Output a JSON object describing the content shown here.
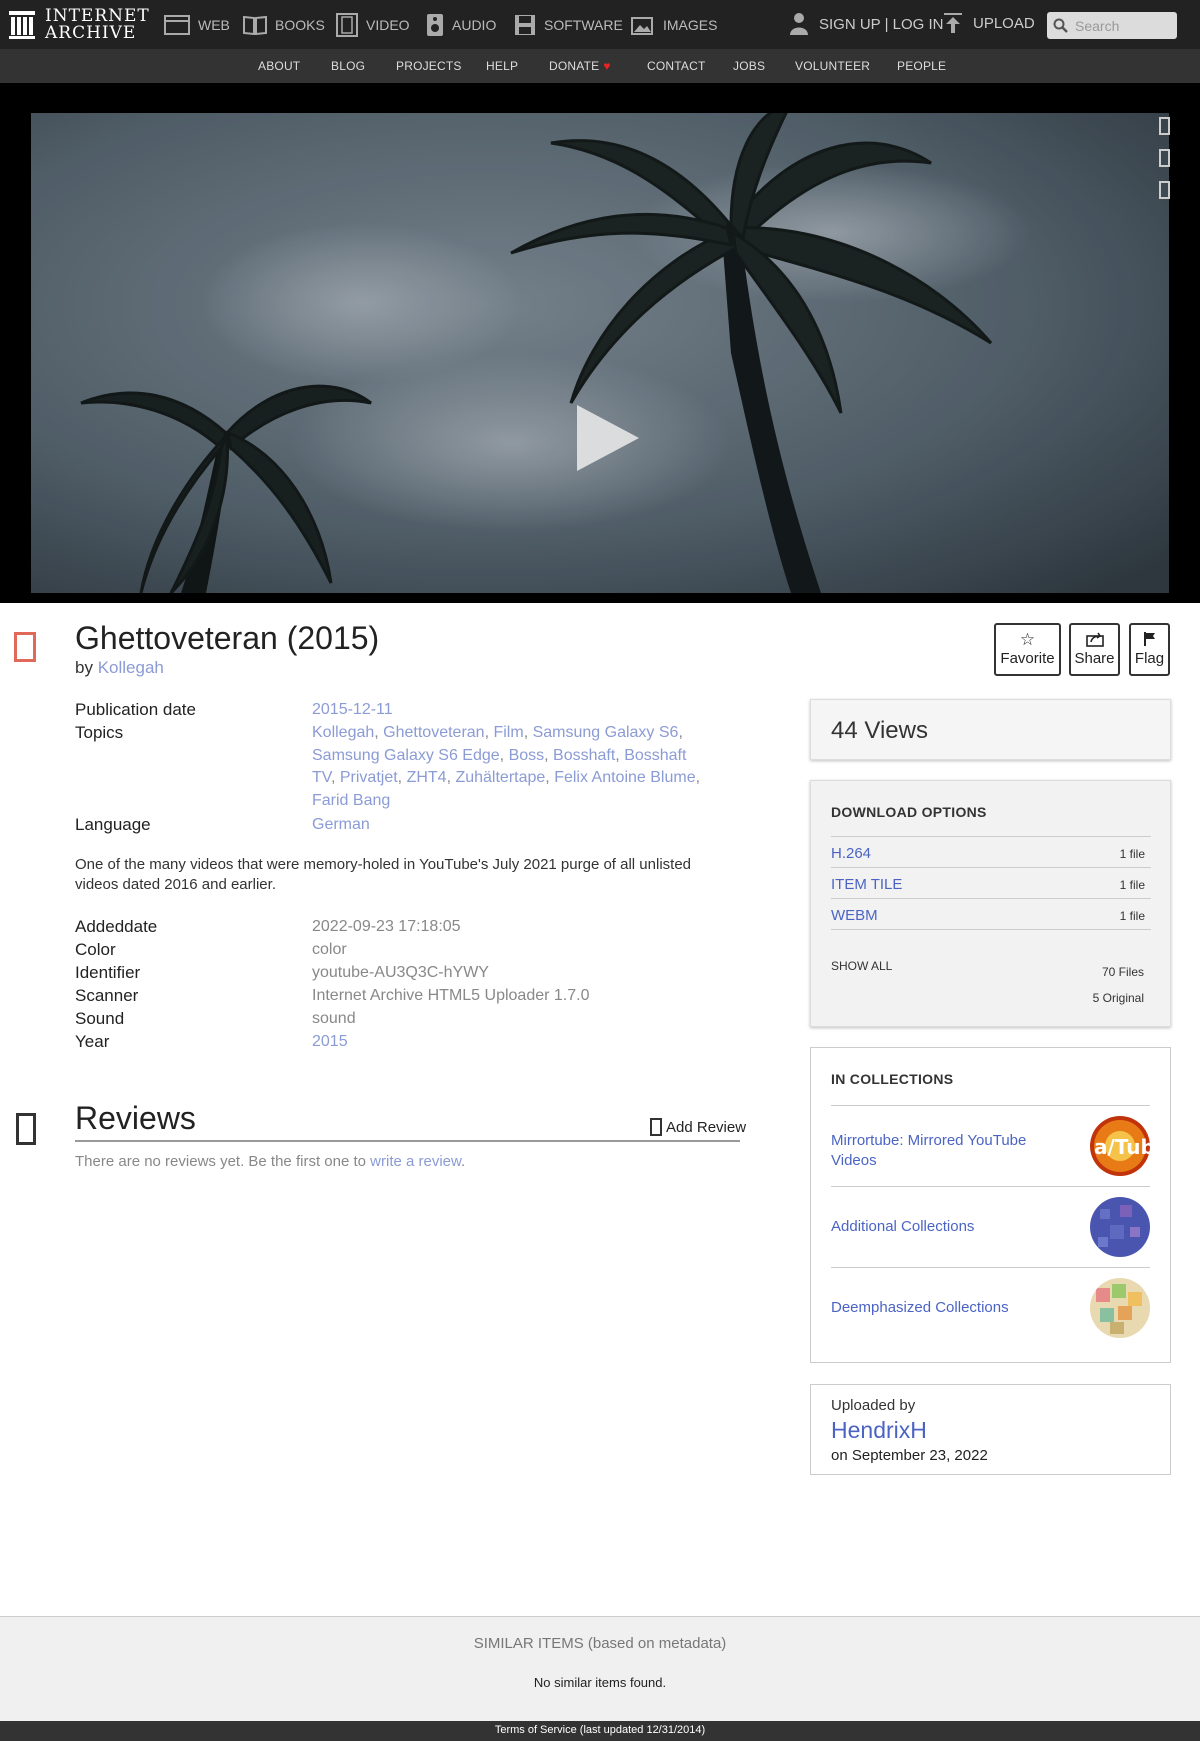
{
  "topnav": {
    "logo_line1": "INTERNET",
    "logo_line2": "ARCHIVE",
    "mediatypes": [
      "WEB",
      "BOOKS",
      "VIDEO",
      "AUDIO",
      "SOFTWARE",
      "IMAGES"
    ],
    "user_link": "SIGN UP | LOG IN",
    "upload": "UPLOAD",
    "search_placeholder": "Search"
  },
  "subnav": [
    "ABOUT",
    "BLOG",
    "PROJECTS",
    "HELP",
    "DONATE",
    "CONTACT",
    "JOBS",
    "VOLUNTEER",
    "PEOPLE"
  ],
  "item": {
    "title": "Ghettoveteran (2015)",
    "by_label": "by",
    "creator": "Kollegah",
    "actions": [
      "Favorite",
      "Share",
      "Flag"
    ]
  },
  "metadata": {
    "publication_date_label": "Publication date",
    "publication_date": "2015-12-11",
    "topics_label": "Topics",
    "topics": [
      "Kollegah",
      "Ghettoveteran",
      "Film",
      "Samsung Galaxy S6",
      "Samsung Galaxy S6 Edge",
      "Boss",
      "Bosshaft",
      "Bosshaft TV",
      "Privatjet",
      "ZHT4",
      "Zuhältertape",
      "Felix Antoine Blume",
      "Farid Bang"
    ],
    "language_label": "Language",
    "language": "German",
    "description": "One of the many videos that were memory-holed in YouTube's July 2021 purge of all unlisted videos dated 2016 and earlier.",
    "fields": [
      {
        "label": "Addeddate",
        "value": "2022-09-23 17:18:05",
        "link": false
      },
      {
        "label": "Color",
        "value": "color",
        "link": false
      },
      {
        "label": "Identifier",
        "value": "youtube-AU3Q3C-hYWY",
        "link": false
      },
      {
        "label": "Scanner",
        "value": "Internet Archive HTML5 Uploader 1.7.0",
        "link": false
      },
      {
        "label": "Sound",
        "value": "sound",
        "link": false
      },
      {
        "label": "Year",
        "value": "2015",
        "link": true
      }
    ]
  },
  "reviews": {
    "title": "Reviews",
    "add_review": "Add Review",
    "empty_text": "There are no reviews yet. Be the first one to",
    "write_link": "write a review",
    "period": "."
  },
  "sidebar": {
    "views_count": "44",
    "views_label": "Views",
    "download_heading": "DOWNLOAD OPTIONS",
    "downloads": [
      {
        "format": "H.264",
        "count": "1 file"
      },
      {
        "format": "ITEM TILE",
        "count": "1 file"
      },
      {
        "format": "WEBM",
        "count": "1 file"
      }
    ],
    "show_all": "SHOW ALL",
    "files_count": "70 Files",
    "original_count": "5 Original",
    "collections_heading": "IN COLLECTIONS",
    "collections": [
      "Mirrortube: Mirrored YouTube Videos",
      "Additional Collections",
      "Deemphasized Collections"
    ],
    "uploaded_by_label": "Uploaded by",
    "uploader": "HendrixH",
    "upload_date": "on September 23, 2022"
  },
  "similar": {
    "title": "SIMILAR ITEMS (based on metadata)",
    "none": "No similar items found."
  },
  "footer": {
    "terms": "Terms of Service (last updated 12/31/2014)"
  },
  "colors": {
    "topnav_bg": "#222222",
    "subnav_bg": "#333333",
    "link": "#4b64c4",
    "meta_link": "#8b9bd5",
    "item_icon": "#e0695a",
    "donate_heart": "#ee2222"
  }
}
